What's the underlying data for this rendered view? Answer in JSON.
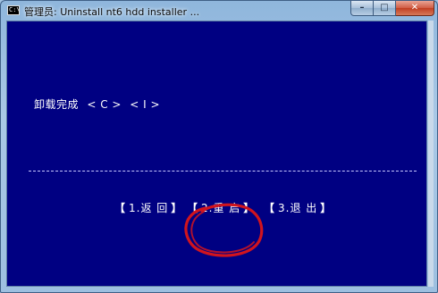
{
  "window": {
    "icon_label": "C:\\",
    "title": "管理员:  Uninstall nt6 hdd installer ..."
  },
  "controls": {
    "minimize": "–",
    "maximize": "□",
    "close": "✕"
  },
  "console": {
    "status": {
      "text": "卸载完成",
      "token1": "< C >",
      "token2": "< I >"
    },
    "divider": "------------------------------------------------------------------------",
    "menu": [
      {
        "open": "【",
        "label": "1.返 回",
        "close": "】"
      },
      {
        "open": "【",
        "label": "2.重 启",
        "close": "】"
      },
      {
        "open": "【",
        "label": "3.退 出",
        "close": "】"
      }
    ]
  },
  "colors": {
    "console_bg": "#000082",
    "console_fg": "#ffffff",
    "annotation": "#d0141e"
  },
  "icons": [
    "console-app-icon",
    "minimize-icon",
    "maximize-icon",
    "close-icon"
  ]
}
